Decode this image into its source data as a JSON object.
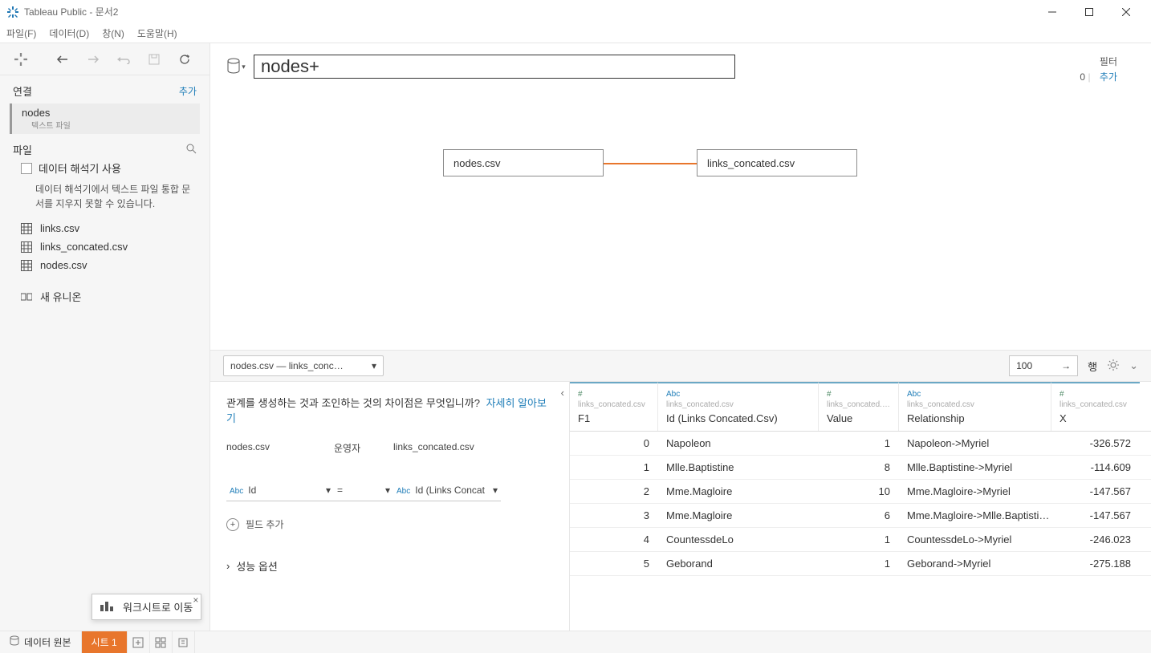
{
  "window": {
    "title": "Tableau Public - 문서2"
  },
  "menubar": [
    "파일(F)",
    "데이터(D)",
    "창(N)",
    "도움말(H)"
  ],
  "sidebar": {
    "connections_header": "연결",
    "add": "추가",
    "connection": {
      "name": "nodes",
      "sub": "텍스트 파일"
    },
    "files_header": "파일",
    "interpreter_label": "데이터 해석기 사용",
    "interpreter_desc": "데이터 해석기에서 텍스트 파일 통합 문서를 지우지 못할 수 있습니다.",
    "files": [
      "links.csv",
      "links_concated.csv",
      "nodes.csv"
    ],
    "new_union": "새 유니온"
  },
  "canvas": {
    "datasource_name": "nodes+",
    "filter_label": "필터",
    "filter_count": "0",
    "filter_add": "추가",
    "node1": "nodes.csv",
    "node2": "links_concated.csv"
  },
  "preview_bar": {
    "dropdown_label": "nodes.csv  —  links_conc…",
    "rows_value": "100",
    "rows_label": "행"
  },
  "rel_panel": {
    "question": "관계를 생성하는 것과 조인하는 것의 차이점은 무엇입니까?",
    "learn_more": "자세히 알아보기",
    "col_left": "nodes.csv",
    "col_mid": "운영자",
    "col_right": "links_concated.csv",
    "left_field": "Id",
    "op": "=",
    "right_field": "Id (Links Concat",
    "add_field": "필드 추가",
    "perf": "성능 옵션"
  },
  "grid": {
    "source": "links_concated.csv",
    "headers": {
      "f1": "F1",
      "id": "Id (Links Concated.Csv)",
      "value": "Value",
      "rel": "Relationship",
      "x": "X"
    },
    "rows": [
      {
        "f1": "0",
        "id": "Napoleon",
        "value": "1",
        "rel": "Napoleon->Myriel",
        "x": "-326.572"
      },
      {
        "f1": "1",
        "id": "Mlle.Baptistine",
        "value": "8",
        "rel": "Mlle.Baptistine->Myriel",
        "x": "-114.609"
      },
      {
        "f1": "2",
        "id": "Mme.Magloire",
        "value": "10",
        "rel": "Mme.Magloire->Myriel",
        "x": "-147.567"
      },
      {
        "f1": "3",
        "id": "Mme.Magloire",
        "value": "6",
        "rel": "Mme.Magloire->Mlle.Baptisti…",
        "x": "-147.567"
      },
      {
        "f1": "4",
        "id": "CountessdeLo",
        "value": "1",
        "rel": "CountessdeLo->Myriel",
        "x": "-246.023"
      },
      {
        "f1": "5",
        "id": "Geborand",
        "value": "1",
        "rel": "Geborand->Myriel",
        "x": "-275.188"
      }
    ]
  },
  "tooltip": {
    "text": "워크시트로 이동"
  },
  "tabs": {
    "datasource": "데이터 원본",
    "sheet1": "시트 1"
  }
}
